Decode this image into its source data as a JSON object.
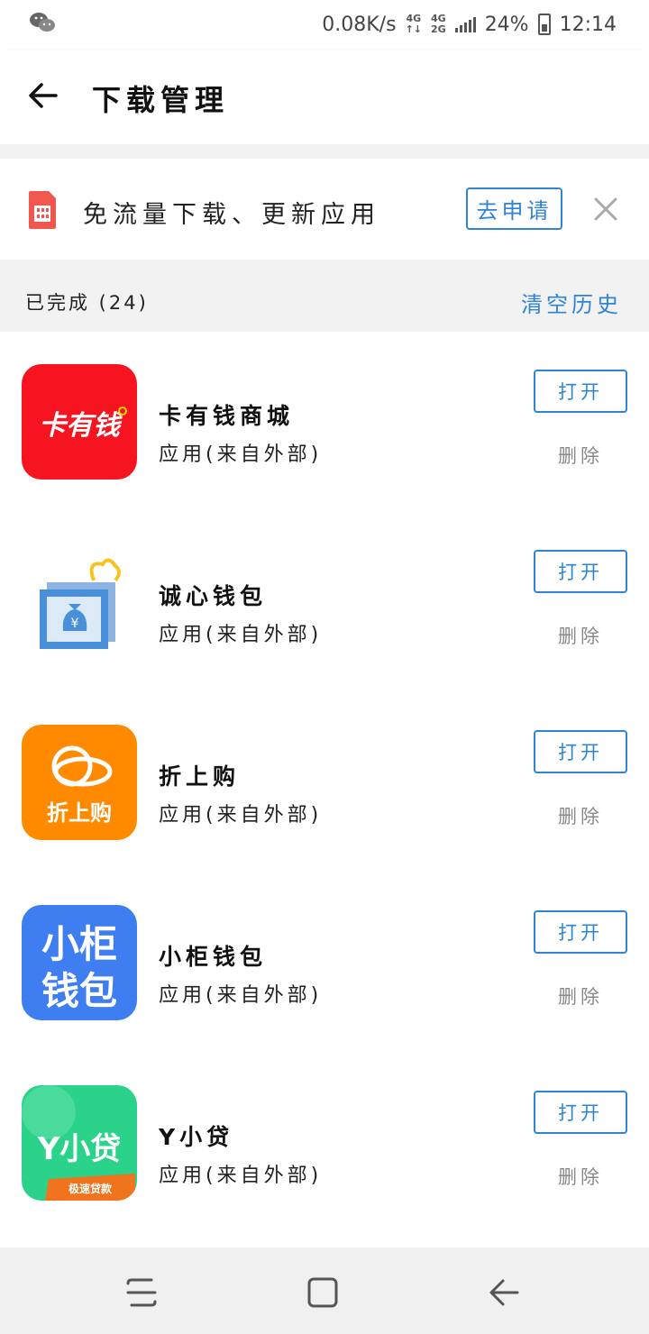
{
  "status_bar": {
    "speed": "0.08K/s",
    "net1_top": "4G",
    "net1_bottom": "↑↓",
    "net2_top": "4G",
    "net2_bottom": "2G",
    "battery": "24%",
    "time": "12:14",
    "left_icon": "wechat-icon"
  },
  "header": {
    "title": "下载管理",
    "back_icon": "back-arrow-icon"
  },
  "promo": {
    "icon": "sim-card-icon",
    "text": "免流量下载、更新应用",
    "apply_label": "去申请",
    "close_icon": "close-icon",
    "accent_color": "#2f84d8"
  },
  "section": {
    "title": "已完成 (24)",
    "clear_label": "清空历史"
  },
  "apps": [
    {
      "name": "卡有钱商城",
      "subtitle": "应用(来自外部)",
      "open_label": "打开",
      "delete_label": "删除",
      "icon_text": "卡有钱",
      "icon_color": "#f5141f"
    },
    {
      "name": "诚心钱包",
      "subtitle": "应用(来自外部)",
      "open_label": "打开",
      "delete_label": "删除",
      "icon_text": "¥",
      "icon_color": "#4a90d9"
    },
    {
      "name": "折上购",
      "subtitle": "应用(来自外部)",
      "open_label": "打开",
      "delete_label": "删除",
      "icon_text": "折上购",
      "icon_color": "#ff8a00"
    },
    {
      "name": "小柜钱包",
      "subtitle": "应用(来自外部)",
      "open_label": "打开",
      "delete_label": "删除",
      "icon_text_1": "小柜",
      "icon_text_2": "钱包",
      "icon_color": "#3f7ef0"
    },
    {
      "name": "Y小贷",
      "subtitle": "应用(来自外部)",
      "open_label": "打开",
      "delete_label": "删除",
      "icon_text": "Y小贷",
      "icon_badge": "极速贷款",
      "icon_color": "#2bd28a"
    }
  ],
  "navbar": {
    "recent_icon": "recent-apps-icon",
    "home_icon": "home-icon",
    "back_icon": "nav-back-icon"
  }
}
